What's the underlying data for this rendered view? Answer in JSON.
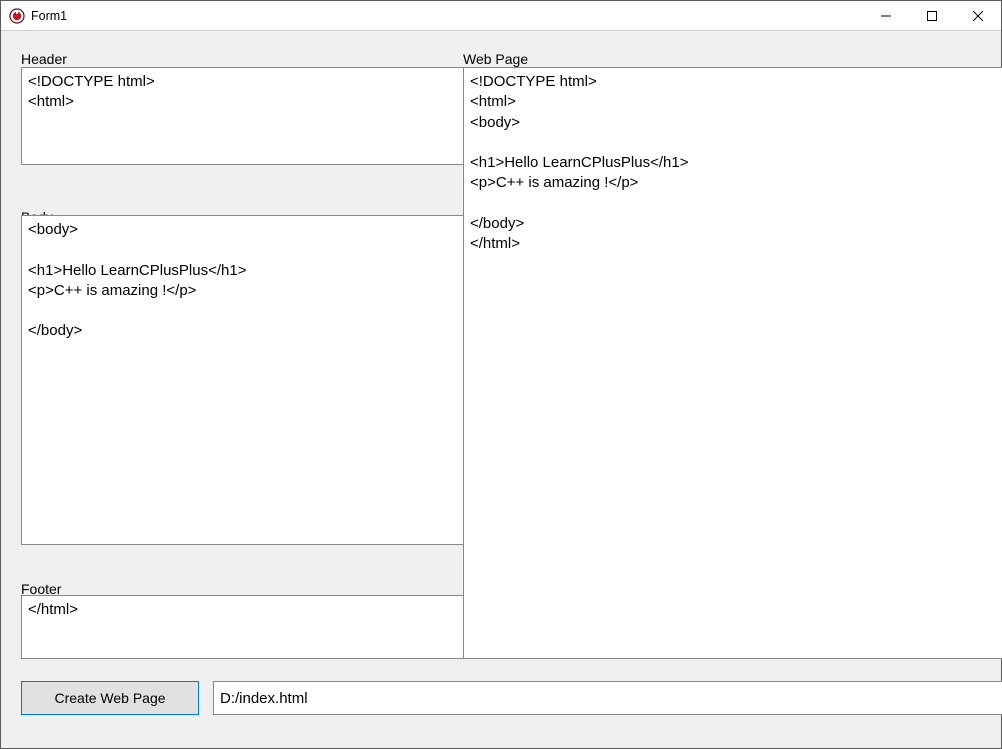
{
  "window": {
    "title": "Form1"
  },
  "labels": {
    "header": "Header",
    "body": "Body",
    "footer": "Footer",
    "webpage": "Web Page"
  },
  "fields": {
    "header": "<!DOCTYPE html>\n<html>",
    "body": "<body>\n\n<h1>Hello LearnCPlusPlus</h1>\n<p>C++ is amazing !</p>\n\n</body>",
    "footer": "</html>",
    "webpage": "<!DOCTYPE html>\n<html>\n<body>\n\n<h1>Hello LearnCPlusPlus</h1>\n<p>C++ is amazing !</p>\n\n</body>\n</html>",
    "path": "D:/index.html"
  },
  "buttons": {
    "create": "Create Web Page"
  }
}
